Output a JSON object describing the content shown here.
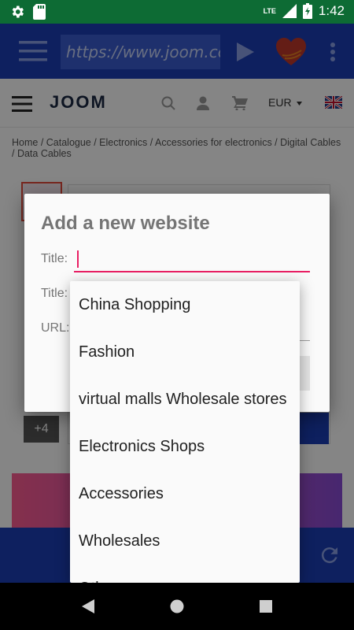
{
  "status_bar": {
    "time": "1:42",
    "network": "LTE"
  },
  "browser": {
    "url": "https://www.joom.com"
  },
  "site": {
    "logo": "JOOM",
    "currency": "EUR",
    "breadcrumb": "Home  /  Catalogue  /  Electronics  /  Accessories for electronics  /  Digital Cables  /  Data Cables",
    "thumb_more": "+4"
  },
  "dialog": {
    "title": "Add a new website",
    "title_label": "Title:",
    "second_label": "Title:",
    "url_label": "URL:",
    "title_value": ""
  },
  "dropdown": {
    "options": [
      "China Shopping",
      "Fashion",
      "virtual malls Wholesale stores",
      "Electronics Shops",
      "Accessories",
      "Wholesales",
      "Other"
    ]
  },
  "colors": {
    "primary": "#1c3fb6",
    "status": "#0d6b34",
    "accent": "#e91e63"
  }
}
